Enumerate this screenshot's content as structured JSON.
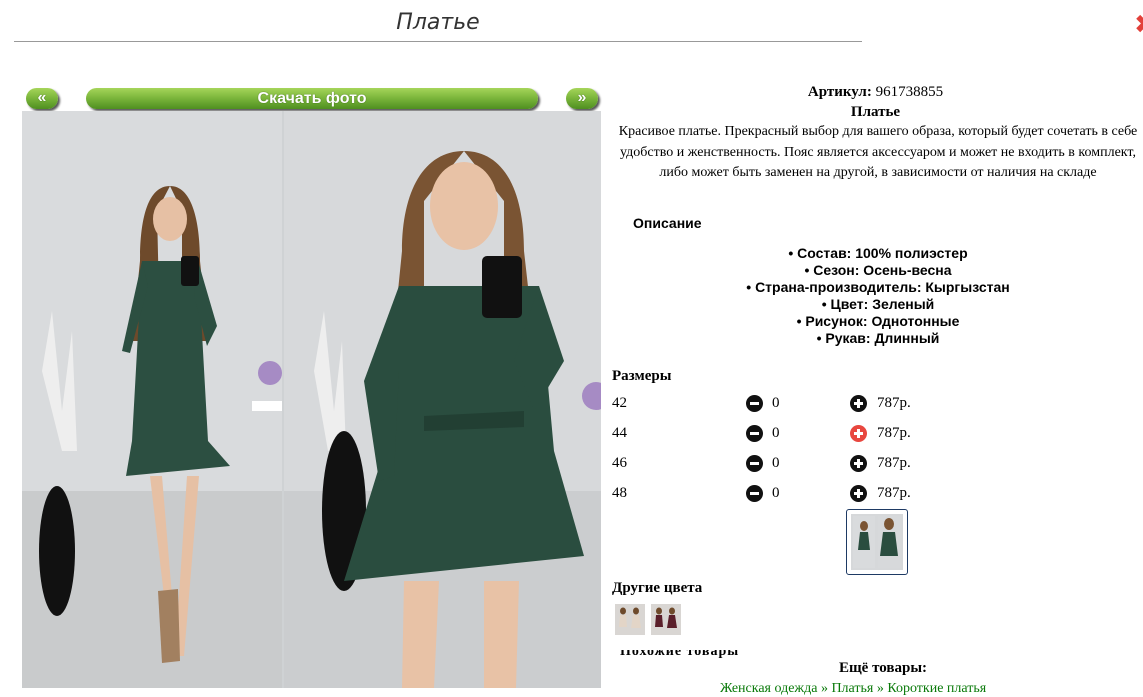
{
  "header": {
    "title": "Платье"
  },
  "nav": {
    "prev_label": "«",
    "download_label": "Скачать фото",
    "next_label": "»"
  },
  "product": {
    "article_label": "Артикул:",
    "article_value": "961738855",
    "name": "Платье",
    "description": "Красивое платье. Прекрасный выбор для вашего образа, который будет сочетать в себе удобство и женственность. Пояс является аксессуаром и может не входить в комплект, либо может быть заменен на другой, в зависимости от наличия на складе",
    "details_heading": "Описание",
    "properties": [
      "Состав: 100% полиэстер",
      "Сезон: Осень-весна",
      "Страна-производитель: Кыргызстан",
      "Цвет: Зеленый",
      "Рисунок: Однотонные",
      "Рукав: Длинный"
    ]
  },
  "sizes": {
    "heading": "Размеры",
    "rows": [
      {
        "size": "42",
        "qty": "0",
        "price": "787р."
      },
      {
        "size": "44",
        "qty": "0",
        "price": "787р."
      },
      {
        "size": "46",
        "qty": "0",
        "price": "787р."
      },
      {
        "size": "48",
        "qty": "0",
        "price": "787р."
      }
    ]
  },
  "colors": {
    "heading": "Другие цвета"
  },
  "more": {
    "heading": "Ещё товары:",
    "links": "Женская одежда » Платья » Короткие платья"
  },
  "icons": {
    "minus": "minus-circle-icon",
    "plus": "plus-circle-icon",
    "close": "close-icon"
  },
  "theme": {
    "accent_green": "#79b43a",
    "plus_active": "#e8473f",
    "link_green": "#0a7a0a"
  }
}
